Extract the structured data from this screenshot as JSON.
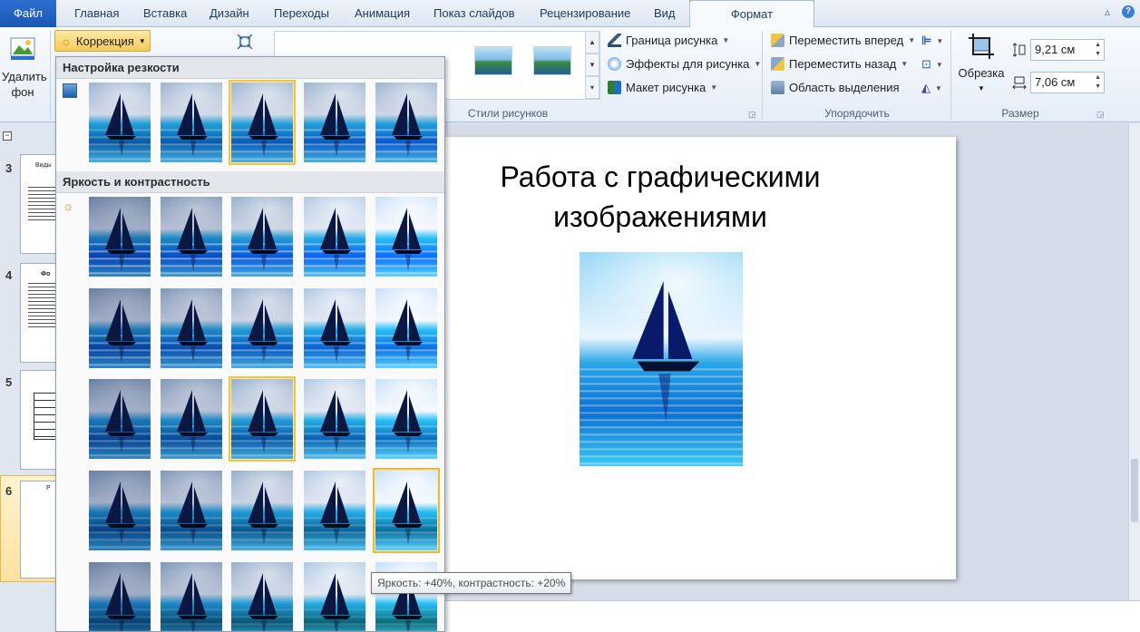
{
  "tabs": [
    "Файл",
    "Главная",
    "Вставка",
    "Дизайн",
    "Переходы",
    "Анимация",
    "Показ слайдов",
    "Рецензирование",
    "Вид",
    "Формат"
  ],
  "ribbon": {
    "remove_bg": "Удалить фон",
    "correction": "Коррекция",
    "styles_label": "Стили рисунков",
    "border": "Граница рисунка",
    "effects": "Эффекты для рисунка",
    "layout": "Макет рисунка",
    "arrange_label": "Упорядочить",
    "bring_forward": "Переместить вперед",
    "send_backward": "Переместить назад",
    "selection_pane": "Область выделения",
    "size_label": "Размер",
    "crop": "Обрезка",
    "height": "9,21 см",
    "width": "7,06 см"
  },
  "slides": {
    "numbers": [
      "3",
      "4",
      "5",
      "6"
    ],
    "thumb_titles": [
      "Виды",
      "Фо",
      "",
      "Р"
    ]
  },
  "slide": {
    "title": "Работа с графическими изображениями"
  },
  "dropdown": {
    "sharpness_header": "Настройка резкости",
    "brightness_header": "Яркость и контрастность",
    "tooltip": "Яркость: +40%, контрастность: +20%"
  },
  "colors": {
    "file_tab": "#2b6fd0",
    "highlight": "#f2c541",
    "format_tab_accent": "#c9a33a"
  }
}
